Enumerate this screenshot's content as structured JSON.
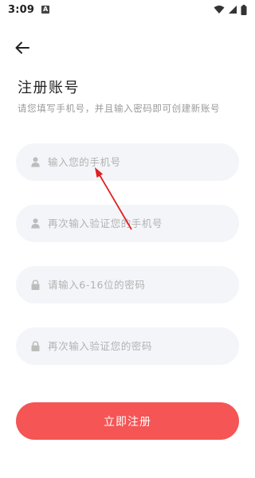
{
  "status_bar": {
    "time": "3:09",
    "icons": [
      "notification-a-icon",
      "wifi-icon",
      "signal-icon",
      "battery-icon"
    ]
  },
  "header": {
    "back_icon": "arrow-left-icon",
    "title": "注册账号",
    "subtitle": "请您填写手机号，并且输入密码即可创建新账号"
  },
  "form": {
    "phone": {
      "icon": "user-icon",
      "placeholder": "输入您的手机号",
      "value": ""
    },
    "phone_confirm": {
      "icon": "user-icon",
      "placeholder": "再次输入验证您的手机号",
      "value": ""
    },
    "password": {
      "icon": "lock-icon",
      "placeholder": "请输入6-16位的密码",
      "value": ""
    },
    "password_confirm": {
      "icon": "lock-icon",
      "placeholder": "再次输入验证您的密码",
      "value": ""
    }
  },
  "submit": {
    "label": "立即注册"
  },
  "colors": {
    "accent": "#f55555",
    "field_bg": "#f4f5f9",
    "placeholder": "#b2b2b2",
    "annotation_arrow": "#e02020"
  }
}
